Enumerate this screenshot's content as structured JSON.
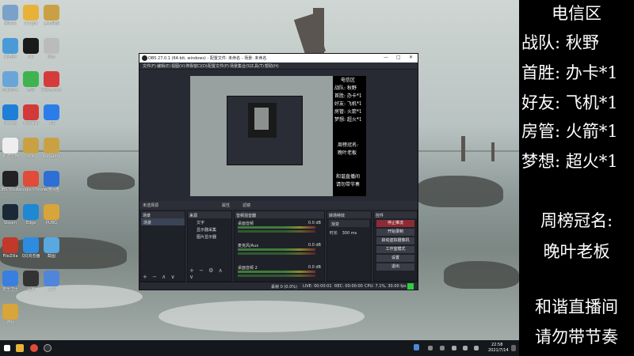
{
  "side_panel": {
    "title": "电信区",
    "lines": [
      "战队: 秋野",
      "首胜: 办卡*1",
      "好友: 飞机*1",
      "房管: 火箭*1",
      "梦想: 超火*1"
    ],
    "rank_title": "周榜冠名:",
    "rank_name": "晚叶老板",
    "notice_1": "和谐直播间",
    "notice_2": "请勿带节奏"
  },
  "obs": {
    "title": "OBS 27.0.1 (64-bit, windows) - 配置文件: 未命名 - 场景: 未命名",
    "window_buttons": [
      "—",
      "□",
      "✕"
    ],
    "menu": [
      "文件(F)",
      "编辑(E)",
      "视图(V)",
      "停靠窗口(D)",
      "配置文件(P)",
      "场景集合(S)",
      "工具(T)",
      "帮助(H)"
    ],
    "preview_panel": [
      "电信区",
      "战队: 秋野",
      "首胜: 办卡*1",
      "好友: 飞机*1",
      "房管: 火箭*1",
      "梦想: 超火*1",
      "周榜冠名:",
      "晚叶老板",
      "和谐直播间",
      "请勿带节奏"
    ],
    "dock_bar": {
      "left": "未选择源",
      "mid1": "属性",
      "mid2": "滤镜"
    },
    "scenes": {
      "header": "场景",
      "items": [
        "场景"
      ]
    },
    "sources": {
      "header": "来源",
      "items": [
        "文字",
        "显示器采集",
        "图片显示器"
      ]
    },
    "mixer": {
      "header": "音频混音器",
      "channels": [
        {
          "name": "桌面音频",
          "db": "0.0 dB"
        },
        {
          "name": "麦克风/Aux",
          "db": "0.0 dB"
        },
        {
          "name": "桌面音频 2",
          "db": "0.0 dB"
        }
      ]
    },
    "transitions": {
      "header": "转场特效",
      "type": "渐变",
      "duration_label": "时长",
      "duration": "300 ms"
    },
    "controls": {
      "header": "控件",
      "buttons": [
        "停止推流",
        "开始录制",
        "启动虚拟摄像机",
        "工作室模式",
        "设置",
        "退出"
      ]
    },
    "status": {
      "dropped": "丢帧 0 (0.0%)",
      "live": "LIVE: 00:00:01",
      "rec": "REC: 00:00:00",
      "cpu": "CPU: 7.1%, 30.00 fps"
    }
  },
  "taskbar": {
    "time": "22:58",
    "date": "2021/7/14"
  },
  "desktop_icons": [
    {
      "label": "回收站",
      "color": "#7aa2c8"
    },
    {
      "label": "Google",
      "color": "#e8b23a"
    },
    {
      "label": "英雄联盟",
      "color": "#c9a144"
    },
    {
      "label": "此电脑",
      "color": "#4b9ad8"
    },
    {
      "label": "QQ",
      "color": "#1a1a1a"
    },
    {
      "label": "鼠标",
      "color": "#bbbbbb"
    },
    {
      "label": "控制面板",
      "color": "#6aa5d9"
    },
    {
      "label": "微信",
      "color": "#3fb34f"
    },
    {
      "label": "网易云音乐",
      "color": "#d63b3b"
    },
    {
      "label": "Nearby",
      "color": "#1f7fd6"
    },
    {
      "label": "金山毒霸",
      "color": "#d23a3a"
    },
    {
      "label": "飞书",
      "color": "#2b7de9"
    },
    {
      "label": "新建文档",
      "color": "#eeeeee"
    },
    {
      "label": "LOL",
      "color": "#c9a144"
    },
    {
      "label": "WeGame",
      "color": "#c9a144"
    },
    {
      "label": "OBS Studio",
      "color": "#222222"
    },
    {
      "label": "Google Chrome",
      "color": "#e04b3a"
    },
    {
      "label": "百度网盘",
      "color": "#2d6fd6"
    },
    {
      "label": "Steam",
      "color": "#1b2838"
    },
    {
      "label": "Edge",
      "color": "#1e88d3"
    },
    {
      "label": "PUBG",
      "color": "#d8a53a"
    },
    {
      "label": "FileZilla",
      "color": "#c0392b"
    },
    {
      "label": "QQ浏览器",
      "color": "#2c8de0"
    },
    {
      "label": "截图",
      "color": "#5aa8e0"
    },
    {
      "label": "安全卫士",
      "color": "#3a7ee0"
    },
    {
      "label": "设置",
      "color": "#333333"
    },
    {
      "label": "工具",
      "color": "#4f86d9"
    },
    {
      "label": "游戏",
      "color": "#d8a53a"
    }
  ]
}
